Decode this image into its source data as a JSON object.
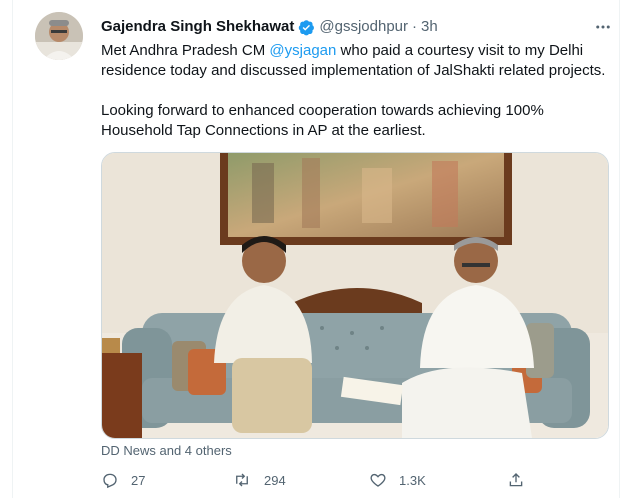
{
  "tweet": {
    "author_name": "Gajendra Singh Shekhawat",
    "handle": "@gssjodhpur",
    "separator": "·",
    "time": "3h",
    "text_line1_a": "Met Andhra Pradesh CM ",
    "mention": "@ysjagan",
    "text_line1_b": " who paid a courtesy visit to my Delhi",
    "text_line2": "residence today and discussed implementation of JalShakti related projects.",
    "text_line3": "Looking forward to enhanced cooperation towards achieving 100%",
    "text_line4": "Household Tap Connections in AP at the earliest.",
    "tagged": "DD News and 4 others",
    "media_alt": "Photo of two men seated on a sofa"
  },
  "actions": {
    "reply_count": "27",
    "retweet_count": "294",
    "like_count": "1.3K"
  },
  "icons": {
    "verified": "verified-badge-icon",
    "more": "more-options-icon",
    "reply": "reply-icon",
    "retweet": "retweet-icon",
    "like": "heart-icon",
    "share": "share-icon"
  },
  "colors": {
    "accent": "#1d9bf0",
    "secondary_text": "#536471",
    "primary_text": "#0f1419"
  }
}
